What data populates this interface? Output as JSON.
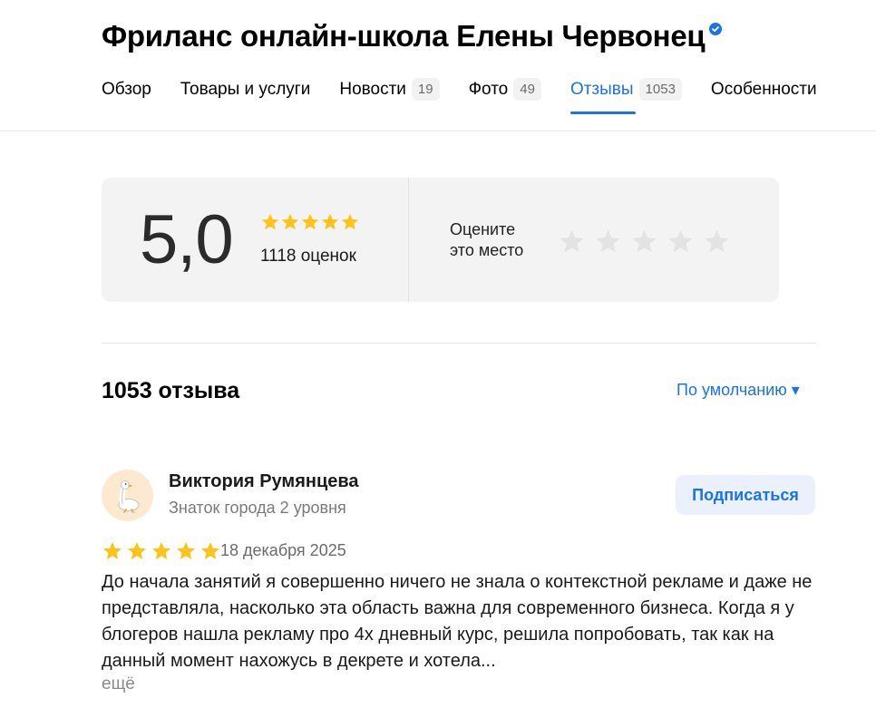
{
  "header": {
    "title": "Фриланс онлайн-школа Елены Червонец",
    "verified_icon": "verified-check-icon"
  },
  "tabs": [
    {
      "label": "Обзор",
      "count": null,
      "active": false
    },
    {
      "label": "Товары и услуги",
      "count": null,
      "active": false
    },
    {
      "label": "Новости",
      "count": "19",
      "active": false
    },
    {
      "label": "Фото",
      "count": "49",
      "active": false
    },
    {
      "label": "Отзывы",
      "count": "1053",
      "active": true
    },
    {
      "label": "Особенности",
      "count": null,
      "active": false
    }
  ],
  "rating": {
    "value": "5,0",
    "stars": 5,
    "count_label": "1118 оценок",
    "rate_prompt_line1": "Оцените",
    "rate_prompt_line2": "это место",
    "user_rating": 0,
    "max_stars": 5
  },
  "reviews_section": {
    "count_label": "1053 отзыва",
    "sort_label": "По умолчанию ▾"
  },
  "review": {
    "author_name": "Виктория Румянцева",
    "author_level": "Знаток города 2 уровня",
    "avatar_icon": "goose-icon",
    "subscribe_label": "Подписаться",
    "stars": 5,
    "date": "18 декабря 2025",
    "text": "До начала занятий я совершенно ничего не знала о контекстной рекламе и даже не представляла, насколько эта область важна для современного бизнеса. Когда я у блогеров нашла рекламу про 4х дневный курс, решила попробовать, так как на данный момент нахожусь в декрете и хотела...",
    "more_label": "ещё"
  },
  "colors": {
    "accent": "#1a73e8",
    "star_filled": "#fcc419",
    "star_empty": "#e3e3e3",
    "card_bg": "#f3f3f3"
  }
}
